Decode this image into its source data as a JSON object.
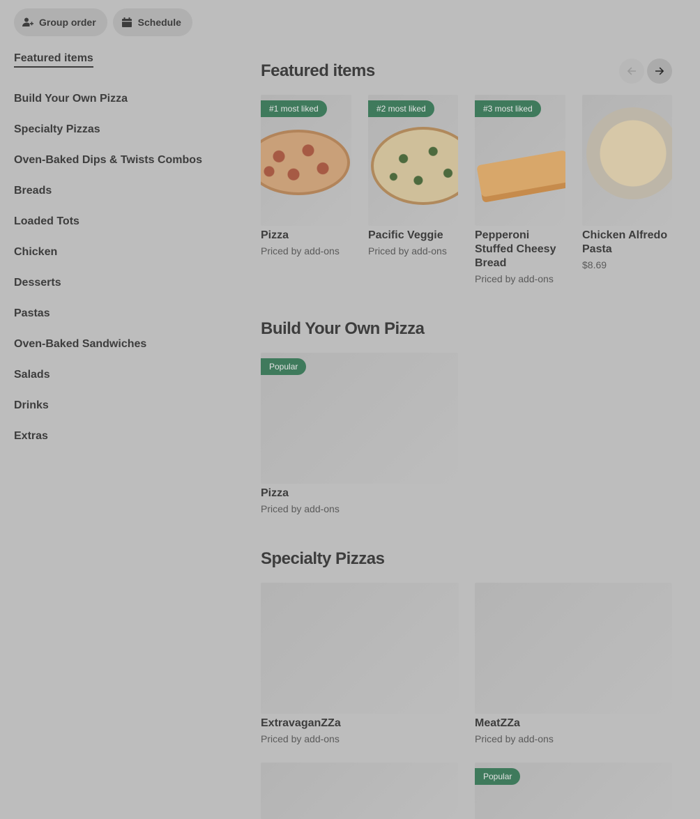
{
  "top_buttons": {
    "group_order": "Group order",
    "schedule": "Schedule"
  },
  "sidebar": {
    "items": [
      {
        "label": "Featured items"
      },
      {
        "label": "Build Your Own Pizza"
      },
      {
        "label": "Specialty Pizzas"
      },
      {
        "label": "Oven-Baked Dips & Twists Combos"
      },
      {
        "label": "Breads"
      },
      {
        "label": "Loaded Tots"
      },
      {
        "label": "Chicken"
      },
      {
        "label": "Desserts"
      },
      {
        "label": "Pastas"
      },
      {
        "label": "Oven-Baked Sandwiches"
      },
      {
        "label": "Salads"
      },
      {
        "label": "Drinks"
      },
      {
        "label": "Extras"
      }
    ]
  },
  "featured": {
    "title": "Featured items",
    "items": [
      {
        "badge": "#1 most liked",
        "name": "Pizza",
        "price": "Priced by add-ons"
      },
      {
        "badge": "#2 most liked",
        "name": "Pacific Veggie",
        "price": "Priced by add-ons"
      },
      {
        "badge": "#3 most liked",
        "name": "Pepperoni Stuffed Cheesy Bread",
        "price": "Priced by add-ons"
      },
      {
        "badge": "",
        "name": "Chicken Alfredo Pasta",
        "price": "$8.69"
      }
    ]
  },
  "build_your_own": {
    "title": "Build Your Own Pizza",
    "items": [
      {
        "badge": "Popular",
        "name": "Pizza",
        "price": "Priced by add-ons"
      }
    ]
  },
  "specialty": {
    "title": "Specialty Pizzas",
    "items": [
      {
        "badge": "",
        "name": "ExtravaganZZa",
        "price": "Priced by add-ons"
      },
      {
        "badge": "",
        "name": "MeatZZa",
        "price": "Priced by add-ons"
      },
      {
        "badge": "",
        "name": "",
        "price": ""
      },
      {
        "badge": "Popular",
        "name": "",
        "price": ""
      }
    ]
  },
  "colors": {
    "overlay_bg": "#bdbdbd",
    "badge": "#3f7a5c",
    "text": "#3d3d3d"
  }
}
